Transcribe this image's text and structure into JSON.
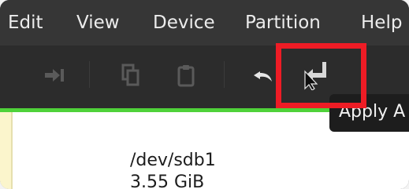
{
  "menubar": {
    "items": [
      "Edit",
      "View",
      "Device",
      "Partition",
      "Help"
    ]
  },
  "toolbar": {
    "buttons": [
      {
        "name": "next-icon",
        "state": "disabled"
      },
      {
        "name": "copy-icon",
        "state": "disabled"
      },
      {
        "name": "paste-icon",
        "state": "disabled"
      },
      {
        "name": "undo-icon",
        "state": "enabled"
      },
      {
        "name": "apply-icon",
        "state": "enabled"
      }
    ]
  },
  "tooltip": {
    "text": "Apply A"
  },
  "partition": {
    "device": "/dev/sdb1",
    "size": "3.55 GiB"
  },
  "colors": {
    "accent_highlight": "#ee1c25",
    "usage_bar": "#4fd23a",
    "background": "#2c2c2c"
  }
}
